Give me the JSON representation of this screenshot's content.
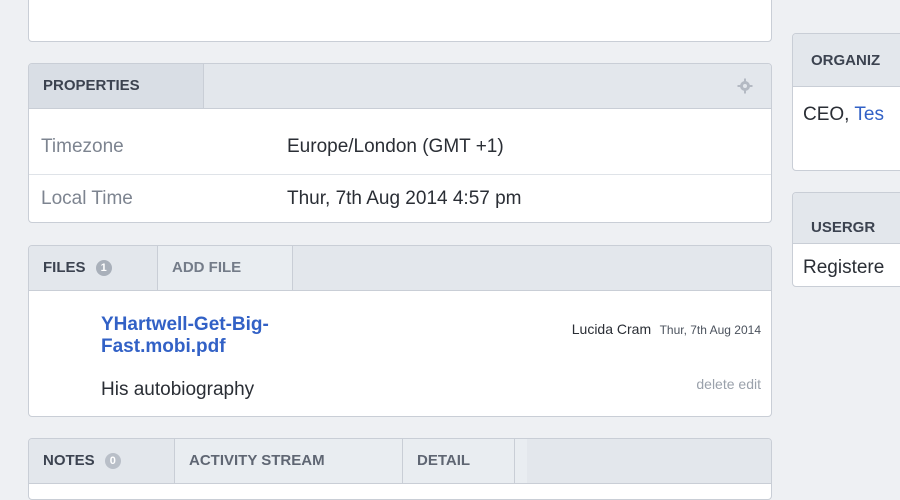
{
  "properties": {
    "title": "PROPERTIES",
    "rows": [
      {
        "label": "Timezone",
        "value": "Europe/London (GMT +1)"
      },
      {
        "label": "Local Time",
        "value": "Thur, 7th Aug 2014 4:57 pm"
      }
    ]
  },
  "files": {
    "tab_label": "FILES",
    "count": "1",
    "add_label": "ADD FILE",
    "items": [
      {
        "name_line1": "YHartwell-Get-Big-",
        "name_line2": "Fast.mobi.pdf",
        "description": "His autobiography",
        "author": "Lucida Cram",
        "date": "Thur, 7th Aug 2014",
        "delete": "delete",
        "edit": "edit"
      }
    ]
  },
  "bottom_tabs": {
    "notes": "NOTES",
    "notes_count": "0",
    "activity": "ACTIVITY STREAM",
    "detail": "DETAIL"
  },
  "organization": {
    "title": "ORGANIZ",
    "role": "CEO, ",
    "company_link": "Tes"
  },
  "usergroups": {
    "title": "USERGR",
    "value": "Registere"
  },
  "icons": {
    "settings": "gear-icon"
  }
}
